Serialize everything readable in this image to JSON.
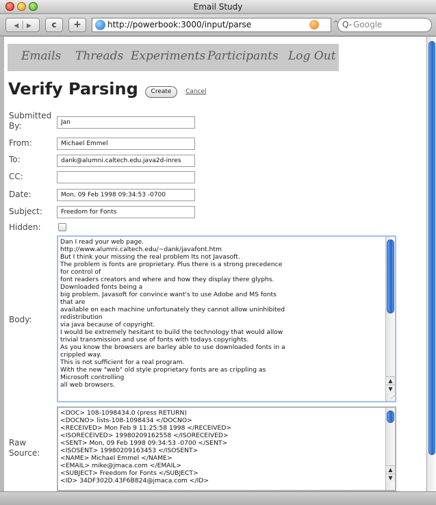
{
  "window": {
    "title": "Email Study"
  },
  "toolbar": {
    "back_label": "◀",
    "forward_label": "▶",
    "reload_label": "c",
    "add_label": "+",
    "url": "http://powerbook:3000/input/parse",
    "search_placeholder": "Google",
    "search_glyph": "Q-"
  },
  "nav": {
    "items": [
      {
        "label": "Emails"
      },
      {
        "label": "Threads"
      },
      {
        "label": "Experiments"
      },
      {
        "label": "Participants"
      },
      {
        "label": "Log Out"
      }
    ]
  },
  "page": {
    "title": "Verify Parsing",
    "create_label": "Create",
    "cancel_label": "Cancel"
  },
  "form": {
    "submitted_by": {
      "label": "Submitted By:",
      "value": "Jan"
    },
    "from": {
      "label": "From:",
      "value": "Michael Emmel"
    },
    "to": {
      "label": "To:",
      "value": "dank@alumni.caltech.edu.java2d-inres"
    },
    "cc": {
      "label": "CC:",
      "value": ""
    },
    "date": {
      "label": "Date:",
      "value": "Mon, 09 Feb 1998 09:34:53 -0700"
    },
    "subject": {
      "label": "Subject:",
      "value": "Freedom for Fonts"
    },
    "hidden": {
      "label": "Hidden:",
      "checked": false
    },
    "body": {
      "label": "Body:",
      "lines": [
        "Dan I read your web page.",
        "http://www.alumni.caltech.edu/~dank/javafont.htm",
        "But I think your missing the real problem Its not Javasoft.",
        "The problem is fonts are proprietary. Plus there is a strong precedence",
        "for control of",
        "font readers creators and where and how they display there glyphs.",
        "Downloaded fonts being a",
        "big problem. Javasoft for convince want's to use Adobe and MS fonts",
        "that are",
        "available on each machine unfortunately they cannot allow uninhibited",
        "redistribution",
        "via java because of copyright.",
        "I would be extremely hesitant to build the technology that would allow",
        "trivial transmission and use of fonts with todays copyrights.",
        "As you know the browsers are barley able to use downloaded fonts in a",
        "crippled way.",
        "This is not sufficient for a real program.",
        "With the new \"web\" old style proprietary fonts are as crippling as",
        "Microsoft controlling",
        "all web browsers."
      ]
    },
    "raw_source": {
      "label": "Raw Source:",
      "lines": [
        "<DOC> 108-1098434.0  (press RETURN)",
        "<DOCNO> lists-108-1098434 </DOCNO>",
        "<RECEIVED> Mon Feb 9 11:25:58 1998 </RECEIVED>",
        "<ISORECEIVED> 19980209162558 </ISORECEIVED>",
        "<SENT> Mon, 09 Feb 1998 09:34:53 -0700 </SENT>",
        "<ISOSENT> 19980209163453 </ISOSENT>",
        "<NAME> Michael Emmel </NAME>",
        "<EMAIL> mike@jmaca.com </EMAIL>",
        "<SUBJECT> Freedom for Fonts </SUBJECT>",
        "<ID> 34DF302D.43F6B824@jmaca.com </ID>"
      ]
    }
  }
}
